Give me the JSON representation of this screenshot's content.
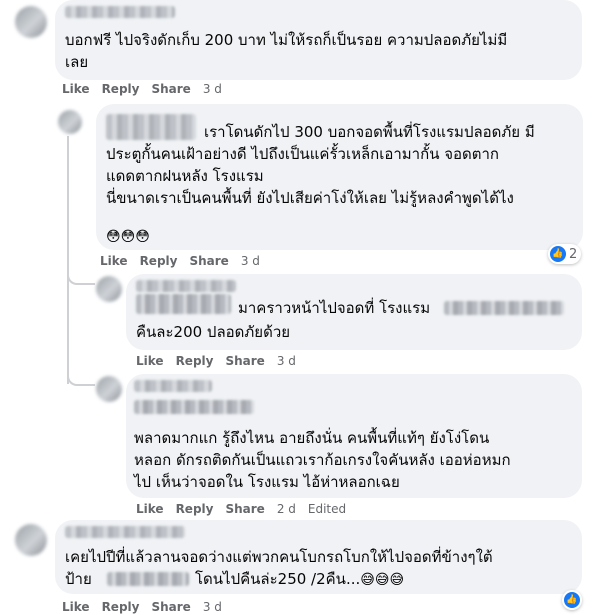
{
  "actions": {
    "like": "Like",
    "reply": "Reply",
    "share": "Share",
    "edited": "Edited"
  },
  "comments": [
    {
      "lines": [
        "บอกฟรี ไปจริงดักเก็บ 200 บาท ไม่ให้รถก็เป็นรอย ความปลอดภัยไม่มี",
        "เลย"
      ],
      "time": "3 d"
    },
    {
      "lines": [
        "เราโดนดักไป 300 บอกจอดพื้นที่โรงแรมปลอดภัย มี",
        "ประตูกั้นคนเฝ้าอย่างดี ไปถึงเป็นแค่รั้วเหล็กเอามากั้น จอดตาก",
        "แดดตากฝนหลัง โรงแรม",
        "นี่ขนาดเราเป็นคนพื้นที่ ยังไปเสียค่าโง่ให้เลย ไม่รู้หลงคำพูดได้ไง"
      ],
      "emojis": "😳😳😳",
      "time": "3 d",
      "reaction_count": "2"
    },
    {
      "lines": [
        "มาคราวหน้าไปจอดที่ โรงแรม",
        "คืนละ200 ปลอดภัยด้วย"
      ],
      "time": "3 d"
    },
    {
      "lines": [
        "พลาดมากแก รู้ถึงไหน อายถึงนั่น คนพื้นที่แท้ๆ ยังโง่โดน",
        "หลอก ดักรถติดกันเป็นแถวเราก้อเกรงใจคันหลัง เออห่อหมก",
        "ไป เห็นว่าจอดใน โรงแรม ไอ้ห่าหลอกเฉย"
      ],
      "time": "2 d",
      "edited": true
    },
    {
      "lines": [
        "เคยไปปีที่แล้วลานจอดว่างแต่พวกคนโบกรถโบกให้ไปจอดที่ข้างๆใต้",
        "ป้าย",
        "โดนไปคืนล่ะ250 /2คืน..."
      ],
      "emojis": "😅😅😅",
      "time": "3 d"
    }
  ]
}
